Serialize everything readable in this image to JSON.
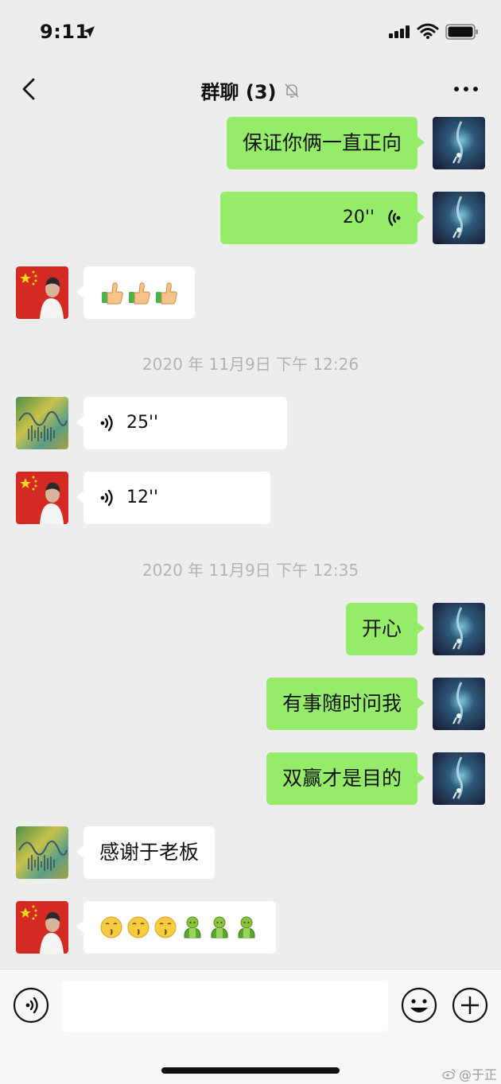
{
  "status_bar": {
    "time": "9:11"
  },
  "nav": {
    "title": "群聊 (3)"
  },
  "messages": [
    {
      "type": "text",
      "dir": "out",
      "text": "保证你俩一直正向"
    },
    {
      "type": "voice",
      "dir": "out",
      "duration": "20''"
    },
    {
      "type": "emoji",
      "dir": "in",
      "emojis": [
        "thumbs-up",
        "thumbs-up",
        "thumbs-up"
      ]
    },
    {
      "type": "timestamp",
      "text": "2020 年 11月9日 下午 12:26"
    },
    {
      "type": "voice",
      "dir": "in",
      "duration": "25''"
    },
    {
      "type": "voice",
      "dir": "in",
      "duration": "12''"
    },
    {
      "type": "timestamp",
      "text": "2020 年 11月9日 下午 12:35"
    },
    {
      "type": "text",
      "dir": "out",
      "text": "开心"
    },
    {
      "type": "text",
      "dir": "out",
      "text": "有事随时问我"
    },
    {
      "type": "text",
      "dir": "out",
      "text": "双赢才是目的"
    },
    {
      "type": "text",
      "dir": "in",
      "text": "感谢于老板"
    },
    {
      "type": "emoji",
      "dir": "in",
      "emojis": [
        "kissing-face",
        "kissing-face",
        "kissing-face",
        "green-figure",
        "green-figure",
        "green-figure"
      ]
    }
  ],
  "input": {
    "placeholder": ""
  },
  "watermark": {
    "text": "@于正"
  },
  "colors": {
    "background": "#ededed",
    "out_bubble": "#95ec69",
    "in_bubble": "#ffffff",
    "timestamp": "#b2b2b2"
  }
}
